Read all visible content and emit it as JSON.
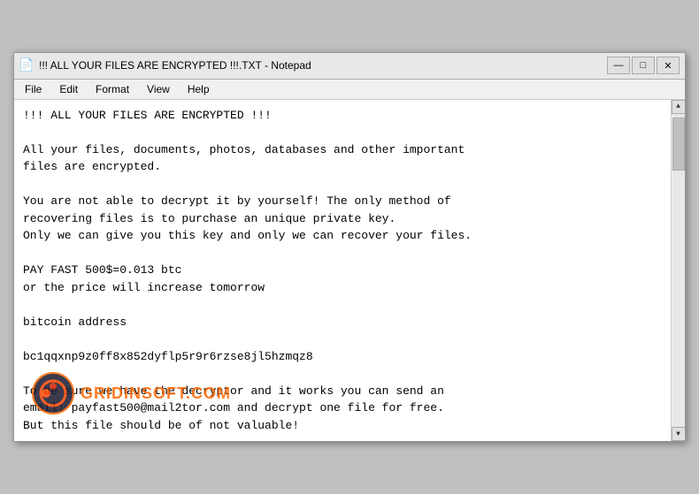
{
  "window": {
    "title": "!!! ALL YOUR FILES ARE ENCRYPTED !!!.TXT - Notepad",
    "icon": "📄"
  },
  "titlebar": {
    "minimize_label": "—",
    "maximize_label": "□",
    "close_label": "✕"
  },
  "menubar": {
    "items": [
      "File",
      "Edit",
      "Format",
      "View",
      "Help"
    ]
  },
  "content": {
    "text": "!!! ALL YOUR FILES ARE ENCRYPTED !!!\n\nAll your files, documents, photos, databases and other important\nfiles are encrypted.\n\nYou are not able to decrypt it by yourself! The only method of\nrecovering files is to purchase an unique private key.\nOnly we can give you this key and only we can recover your files.\n\nPAY FAST 500$=0.013 btc\nor the price will increase tomorrow\n\nbitcoin address\n\nbc1qqxnp9z0ff8x852dyflp5r9r6rzse8jl5hzmqz8\n\nTo be sure we have the decryptor and it works you can send an\nemail: payfast500@mail2tor.com and decrypt one file for free.\nBut this file should be of not valuable!"
  },
  "watermark": {
    "text": "GRIDINSOFT.COM"
  }
}
